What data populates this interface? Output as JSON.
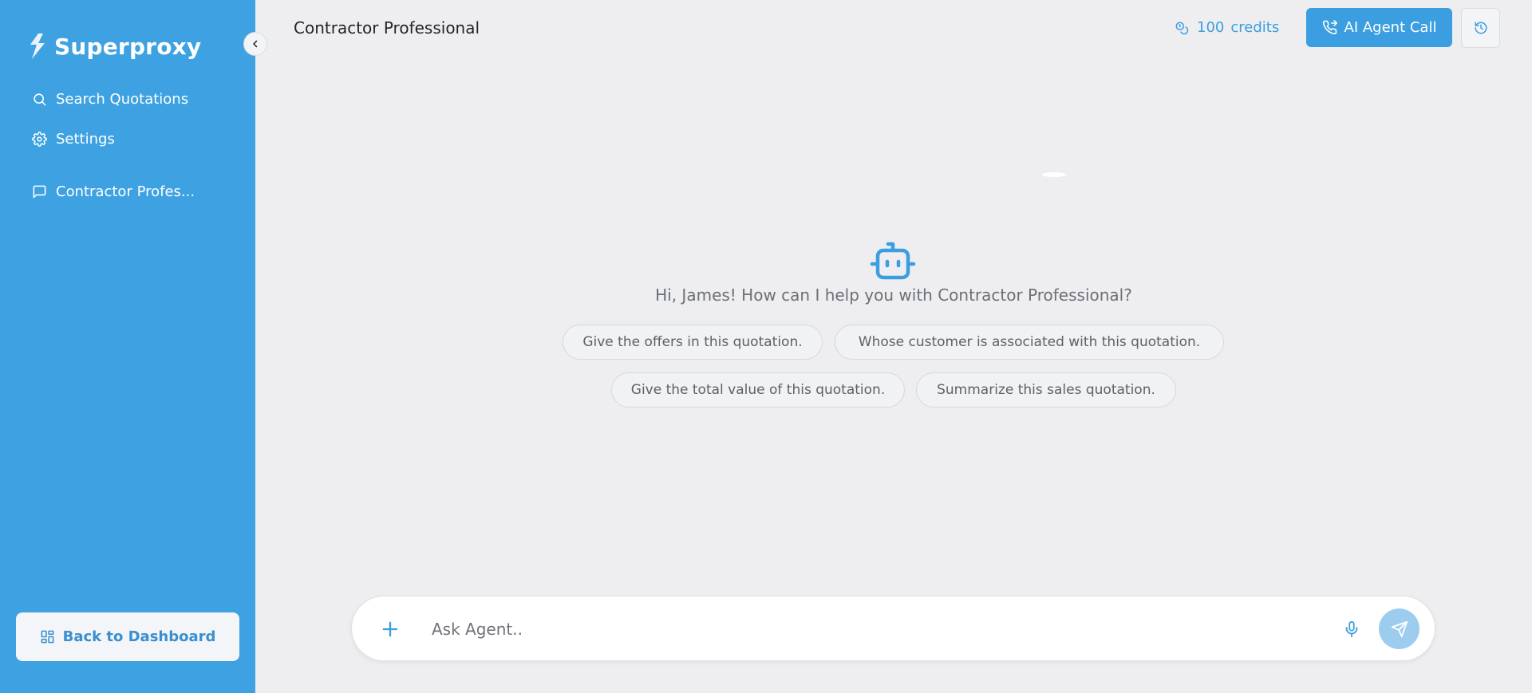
{
  "colors": {
    "sidebar_bg": "#3da1e2",
    "accent": "#3a9ee0",
    "page_bg": "#eeeef1",
    "send_disabled": "#9ccdee"
  },
  "sidebar": {
    "brand": "Superproxy",
    "nav": [
      {
        "label": "Search Quotations",
        "icon": "search-icon"
      },
      {
        "label": "Settings",
        "icon": "gear-icon"
      }
    ],
    "chats": [
      {
        "label": "Contractor Profes...",
        "icon": "chat-bubble-icon"
      }
    ],
    "back_button": {
      "label": "Back to Dashboard",
      "icon": "dashboard-grid-icon"
    }
  },
  "header": {
    "title": "Contractor Professional",
    "credits": {
      "value": "100",
      "unit": "credits",
      "icon": "coins-icon"
    },
    "agent_call": {
      "label": "AI Agent Call",
      "icon": "phone-forward-icon"
    },
    "history_icon": "history-icon"
  },
  "main": {
    "greeting": "Hi, James! How can I help you with Contractor Professional?",
    "suggestions": [
      "Give the offers in this quotation.",
      "Whose customer is associated with this quotation.",
      "Give the total value of this quotation.",
      "Summarize this sales quotation."
    ]
  },
  "composer": {
    "placeholder": "Ask Agent..",
    "icons": [
      "plus-icon",
      "microphone-icon",
      "send-icon"
    ]
  }
}
